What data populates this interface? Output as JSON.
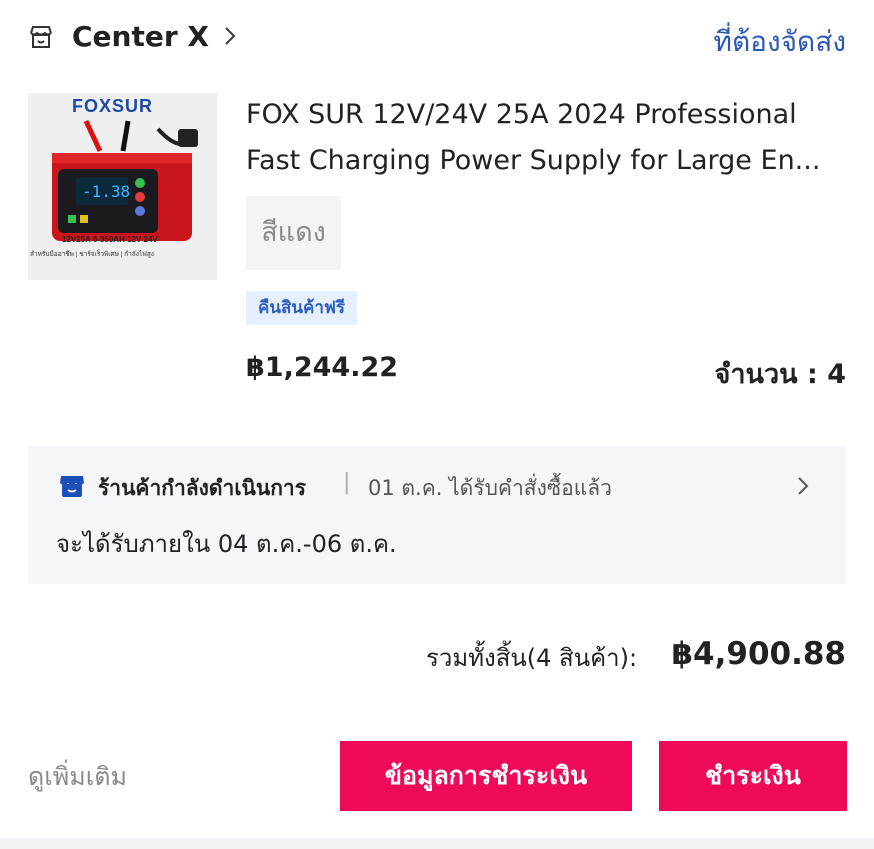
{
  "store": {
    "name": "Center X",
    "order_status": "ที่ต้องจัดส่ง"
  },
  "product": {
    "image": {
      "brand": "FOXSUR",
      "spec": "12V25A  6-350AH  12V 24V",
      "features": "สำหรับมืออาชีพ | ชาร์จเร็วพิเศษ | กำลังไฟสูง"
    },
    "title_line1": "FOX SUR 12V/24V 25A 2024 Professional",
    "title_line2": "Fast Charging Power Supply for Large En...",
    "variant": "สีแดง",
    "return_badge": "คืนสินค้าฟรี",
    "price": "฿1,244.22",
    "quantity": "จำนวน : 4"
  },
  "shipping": {
    "status": "ร้านค้ากำลังดำเนินการ",
    "separator": "|",
    "detail": "01 ต.ค. ได้รับคำสั่งซื้อแล้ว",
    "eta": "จะได้รับภายใน 04 ต.ค.-06 ต.ค."
  },
  "summary": {
    "total_label": "รวมทั้งสิ้น(4 สินค้า):",
    "total_value": "฿4,900.88"
  },
  "actions": {
    "more": "ดูเพิ่มเติม",
    "payment_info": "ข้อมูลการชำระเงิน",
    "pay": "ชำระเงิน"
  },
  "colors": {
    "accent": "#ee0a59",
    "link": "#2a58b8",
    "badge_bg": "#e6effd",
    "badge_text": "#2b5fc0"
  }
}
